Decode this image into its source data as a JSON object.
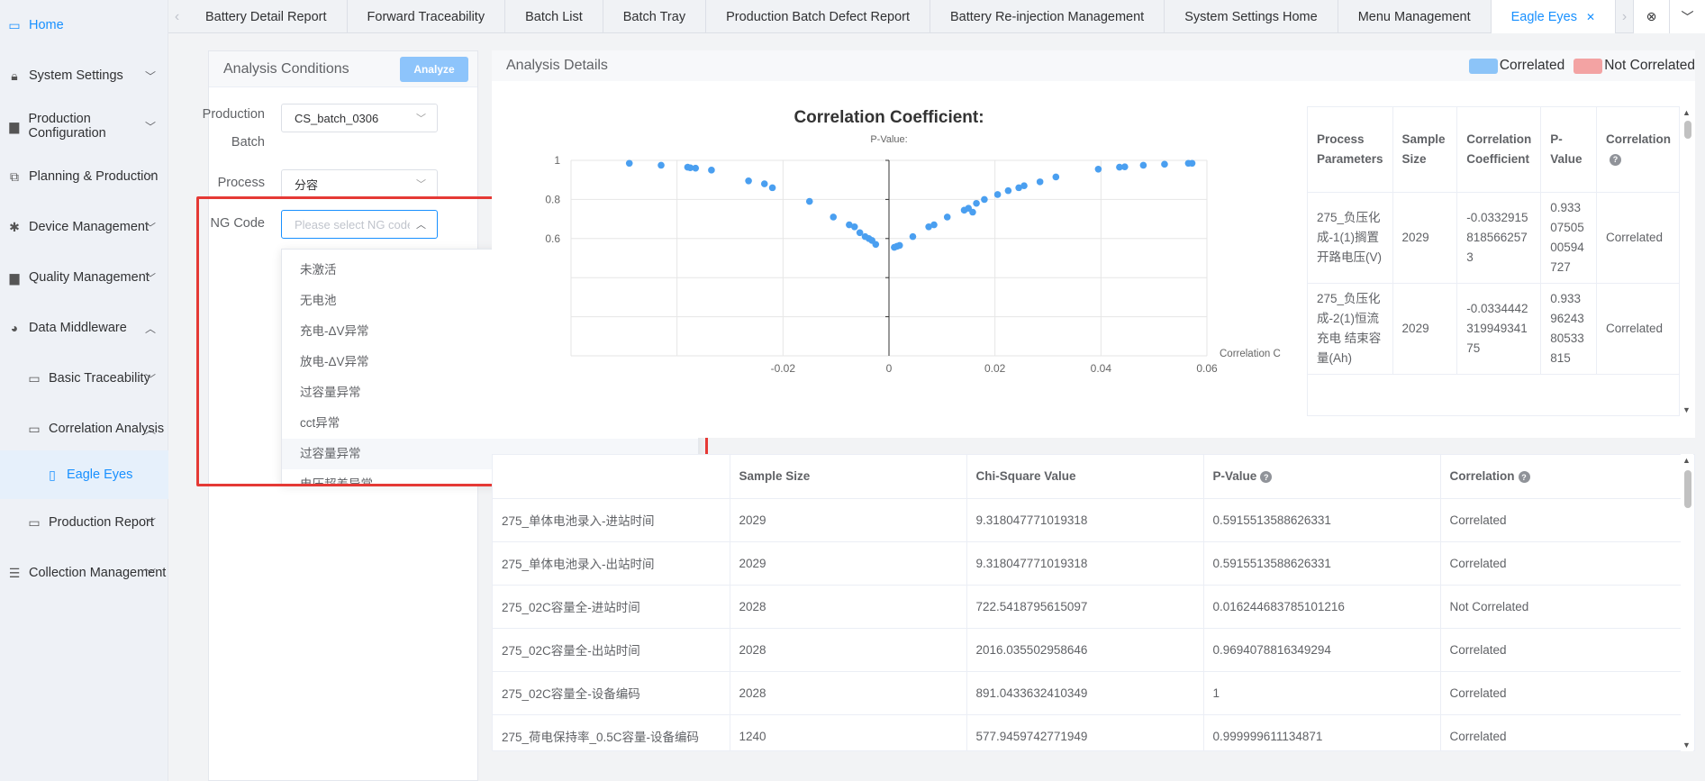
{
  "sidebar": {
    "items": [
      {
        "label": "Home",
        "icon": "monitor-icon"
      },
      {
        "label": "System Settings",
        "icon": "lock-icon"
      },
      {
        "label": "Production Configuration",
        "icon": "briefcase-icon"
      },
      {
        "label": "Planning & Production",
        "icon": "link-icon"
      },
      {
        "label": "Device Management",
        "icon": "asterisk-icon"
      },
      {
        "label": "Quality Management",
        "icon": "briefcase-icon"
      },
      {
        "label": "Data Middleware",
        "icon": "pie-icon"
      },
      {
        "label": "Basic Traceability",
        "icon": "folder-icon"
      },
      {
        "label": "Correlation Analysis",
        "icon": "folder-icon"
      },
      {
        "label": "Eagle Eyes",
        "icon": "document-icon"
      },
      {
        "label": "Production Report",
        "icon": "folder-icon"
      },
      {
        "label": "Collection Management",
        "icon": "database-icon"
      }
    ]
  },
  "tabs": {
    "items": [
      "Battery Detail Report",
      "Forward Traceability",
      "Batch List",
      "Batch Tray",
      "Production Batch Defect Report",
      "Battery Re-injection Management",
      "System Settings Home",
      "Menu Management",
      "Eagle Eyes"
    ]
  },
  "conditions": {
    "title": "Analysis Conditions",
    "analyze_label": "Analyze",
    "batch_label_1": "Production",
    "batch_label_2": "Batch",
    "batch_value": "CS_batch_0306",
    "process_label": "Process",
    "process_value": "分容",
    "ng_label": "NG Code",
    "ng_placeholder": "Please select NG code",
    "ng_options": [
      "未激活",
      "无电池",
      "充电-ΔV异常",
      "放电-ΔV异常",
      "过容量异常",
      "cct异常",
      "过容量异常",
      "电压超差异常"
    ]
  },
  "details": {
    "title": "Analysis Details",
    "legend_correlated": "Correlated",
    "legend_not_correlated": "Not Correlated",
    "color_correlated": "#8cc4f8",
    "color_not_correlated": "#f3a3a3"
  },
  "chart_data": {
    "type": "scatter",
    "title": "Correlation Coefficient:",
    "subtitle": "P-Value:",
    "xlabel": "Correlation C",
    "xlim": [
      -0.06,
      0.06
    ],
    "ylim": [
      0,
      1
    ],
    "x_ticks": [
      "-0.02",
      "0",
      "0.02",
      "0.04",
      "0.06"
    ],
    "y_ticks": [
      "1",
      "0.8",
      "0.6"
    ],
    "points": [
      [
        -0.049,
        0.985
      ],
      [
        -0.043,
        0.975
      ],
      [
        -0.038,
        0.965
      ],
      [
        -0.0375,
        0.962
      ],
      [
        -0.0365,
        0.96
      ],
      [
        -0.0335,
        0.95
      ],
      [
        -0.0265,
        0.895
      ],
      [
        -0.0235,
        0.88
      ],
      [
        -0.022,
        0.86
      ],
      [
        -0.015,
        0.79
      ],
      [
        -0.0105,
        0.71
      ],
      [
        -0.0075,
        0.67
      ],
      [
        -0.0065,
        0.66
      ],
      [
        -0.0055,
        0.63
      ],
      [
        -0.0045,
        0.61
      ],
      [
        -0.0038,
        0.6
      ],
      [
        -0.0032,
        0.59
      ],
      [
        -0.0025,
        0.57
      ],
      [
        0.001,
        0.555
      ],
      [
        0.0015,
        0.56
      ],
      [
        0.002,
        0.565
      ],
      [
        0.0045,
        0.61
      ],
      [
        0.0075,
        0.66
      ],
      [
        0.0085,
        0.67
      ],
      [
        0.011,
        0.71
      ],
      [
        0.0142,
        0.745
      ],
      [
        0.015,
        0.755
      ],
      [
        0.0158,
        0.735
      ],
      [
        0.0165,
        0.78
      ],
      [
        0.018,
        0.8
      ],
      [
        0.0205,
        0.825
      ],
      [
        0.0225,
        0.845
      ],
      [
        0.0245,
        0.86
      ],
      [
        0.0255,
        0.87
      ],
      [
        0.0285,
        0.89
      ],
      [
        0.0315,
        0.915
      ],
      [
        0.0395,
        0.955
      ],
      [
        0.0435,
        0.965
      ],
      [
        0.0445,
        0.967
      ],
      [
        0.048,
        0.975
      ],
      [
        0.052,
        0.98
      ],
      [
        0.0565,
        0.985
      ],
      [
        0.0572,
        0.985
      ]
    ]
  },
  "right_table": {
    "headers": [
      "Process Parameters",
      "Sample Size",
      "Correlation Coefficient",
      "P-Value",
      "Correlation"
    ],
    "rows": [
      [
        "275_负压化成-1(1)搁置 开路电压(V)",
        "2029",
        "-0.033291581856625​73",
        "0.9330750500594727",
        "Correlated"
      ],
      [
        "275_负压化成-2(1)恒流充电 结束容量(Ah)",
        "2029",
        "-0.033444231994934175",
        "0.9339624380533815",
        "Correlated"
      ]
    ]
  },
  "bottom_table": {
    "headers": [
      "",
      "Sample Size",
      "Chi-Square Value",
      "P-Value",
      "Correlation"
    ],
    "rows": [
      [
        "275_单体电池录入-进站时间",
        "2029",
        "9.318047771019318",
        "0.5915513588626331",
        "Correlated"
      ],
      [
        "275_单体电池录入-出站时间",
        "2029",
        "9.318047771019318",
        "0.5915513588626331",
        "Correlated"
      ],
      [
        "275_02C容量全-进站时间",
        "2028",
        "722.5418795615097",
        "0.016244683785101216",
        "Not Correlated"
      ],
      [
        "275_02C容量全-出站时间",
        "2028",
        "2016.035502958646",
        "0.9694078816349294",
        "Correlated"
      ],
      [
        "275_02C容量全-设备编码",
        "2028",
        "891.0433632410349",
        "1",
        "Correlated"
      ],
      [
        "275_荷电保持率_0.5C容量-设备编码",
        "1240",
        "577.9459742771949",
        "0.999999611134871",
        "Correlated"
      ]
    ]
  }
}
